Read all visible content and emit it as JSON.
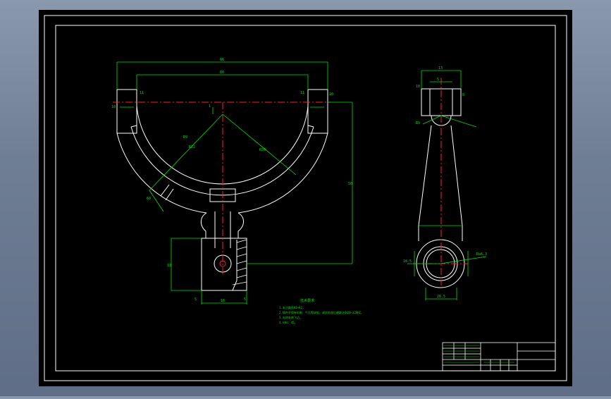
{
  "drawing": {
    "background": "#000000",
    "colors": {
      "outline": "#ffffff",
      "dimension": "#00e000",
      "centerline": "#ff2020",
      "hatch": "#ffffff"
    },
    "dims": {
      "top_total": "86",
      "top_inner": "80",
      "left_small": "11",
      "left_height": "10",
      "right_small": "11",
      "right_height": "10",
      "center_short": "1",
      "r_inner": "R9",
      "r_mid": "R22",
      "r_outer": "R28",
      "vertical_long": "50",
      "hole_height": "18",
      "bottom_width": "16",
      "bottom_left": "5",
      "bottom_right": "5",
      "angle": "60",
      "side_top": "13",
      "side_sub": "5",
      "side_left": "10",
      "side_right": "8",
      "side_radius": "R9",
      "side_hole": "16.5",
      "side_bottom": "26.5",
      "side_note": "Ra6.3"
    },
    "notes": {
      "title": "技术要求",
      "lines": [
        "1.未注圆角R1~R2。",
        "2.铸件不得有砂眼、气孔等缺陷，调质处理后硬度达到28~32HRC。",
        "3.去除毛刺飞边。",
        "4.材料：45。"
      ]
    },
    "title_block": {
      "rows": [
        "",
        "",
        "",
        "",
        ""
      ],
      "cells": [
        "",
        "",
        "",
        ""
      ]
    }
  }
}
